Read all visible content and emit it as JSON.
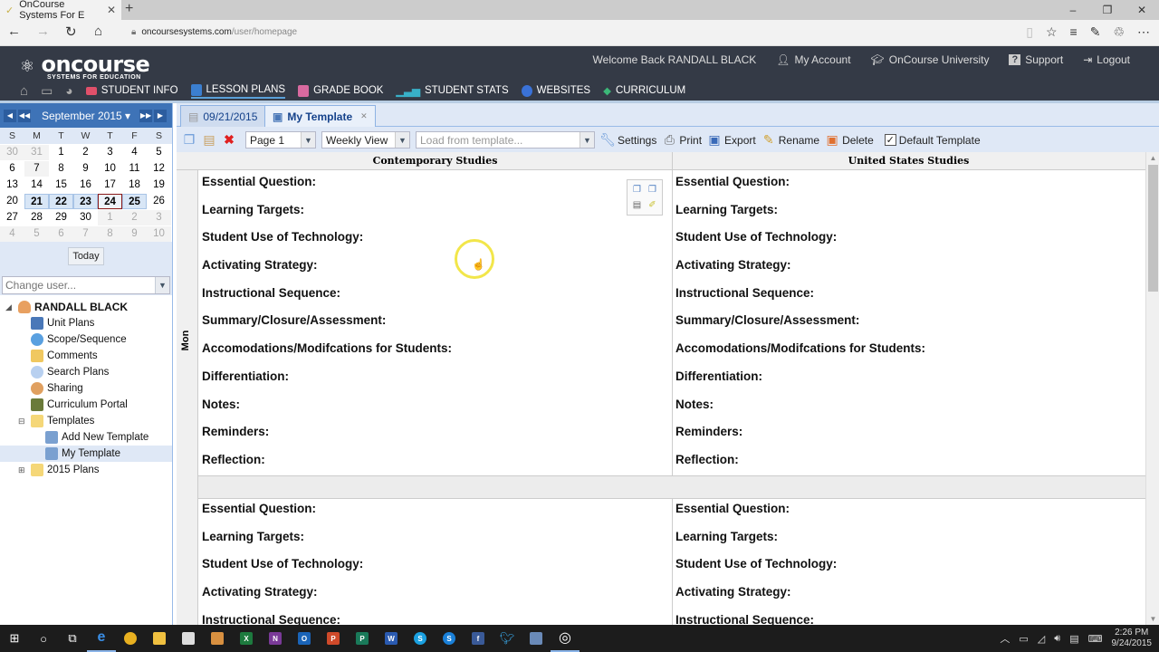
{
  "browser": {
    "tab_title": "OnCourse Systems For E",
    "new_tab": "+",
    "url_domain": "oncoursesystems.com",
    "url_path": "/user/homepage",
    "window_controls": [
      "–",
      "❐",
      "✕"
    ]
  },
  "app": {
    "logo_text": "oncourse",
    "logo_sub": "SYSTEMS FOR EDUCATION",
    "welcome": "Welcome Back RANDALL BLACK",
    "top_links": [
      {
        "label": "My Account",
        "icon": "user-icon"
      },
      {
        "label": "OnCourse University",
        "icon": "graduation-cap-icon"
      },
      {
        "label": "Support",
        "icon": "help-icon"
      },
      {
        "label": "Logout",
        "icon": "logout-icon"
      }
    ],
    "nav": [
      {
        "label": "STUDENT INFO",
        "color": "#e0506a"
      },
      {
        "label": "LESSON PLANS",
        "color": "#3b7fd0",
        "active": true
      },
      {
        "label": "GRADE BOOK",
        "color": "#d86aa0"
      },
      {
        "label": "STUDENT STATS",
        "color": "#38b0c8"
      },
      {
        "label": "WEBSITES",
        "color": "#3a72d8"
      },
      {
        "label": "CURRICULUM",
        "color": "#3cb878"
      }
    ]
  },
  "calendar": {
    "month_label": "September 2015 ▾",
    "dow": [
      "S",
      "M",
      "T",
      "W",
      "T",
      "F",
      "S"
    ],
    "weeks": [
      [
        "30",
        "31",
        "1",
        "2",
        "3",
        "4",
        "5"
      ],
      [
        "6",
        "7",
        "8",
        "9",
        "10",
        "11",
        "12"
      ],
      [
        "13",
        "14",
        "15",
        "16",
        "17",
        "18",
        "19"
      ],
      [
        "20",
        "21",
        "22",
        "23",
        "24",
        "25",
        "26"
      ],
      [
        "27",
        "28",
        "29",
        "30",
        "1",
        "2",
        "3"
      ],
      [
        "4",
        "5",
        "6",
        "7",
        "8",
        "9",
        "10"
      ]
    ],
    "today_button": "Today",
    "selected_days": [
      "21",
      "22",
      "23",
      "24",
      "25"
    ],
    "today": "24"
  },
  "change_user": {
    "placeholder": "Change user..."
  },
  "tree": {
    "root": "RANDALL BLACK",
    "items": [
      "Unit Plans",
      "Scope/Sequence",
      "Comments",
      "Search Plans",
      "Sharing",
      "Curriculum Portal"
    ],
    "templates_folder": "Templates",
    "template_items": [
      "Add New Template",
      "My Template"
    ],
    "plans_folder": "2015 Plans"
  },
  "tabs": [
    {
      "label": "09/21/2015"
    },
    {
      "label": "My Template",
      "active": true,
      "close": "✕"
    }
  ],
  "toolbar": {
    "page_select": "Page 1",
    "view_select": "Weekly View",
    "template_placeholder": "Load from template...",
    "settings": "Settings",
    "print": "Print",
    "export": "Export",
    "rename": "Rename",
    "delete": "Delete",
    "default_template": "Default Template",
    "default_checked": true
  },
  "grid": {
    "columns": [
      "Contemporary Studies",
      "United States Studies"
    ],
    "day_label": "Mon",
    "fields": [
      "Essential Question:",
      "Learning Targets:",
      "Student Use of Technology:",
      "Activating Strategy:",
      "Instructional Sequence:",
      "Summary/Closure/Assessment:",
      "Accomodations/Modifcations for Students:",
      "Differentiation:",
      "Notes:",
      "Reminders:",
      "Reflection:"
    ]
  },
  "taskbar": {
    "time": "2:26 PM",
    "date": "9/24/2015"
  }
}
